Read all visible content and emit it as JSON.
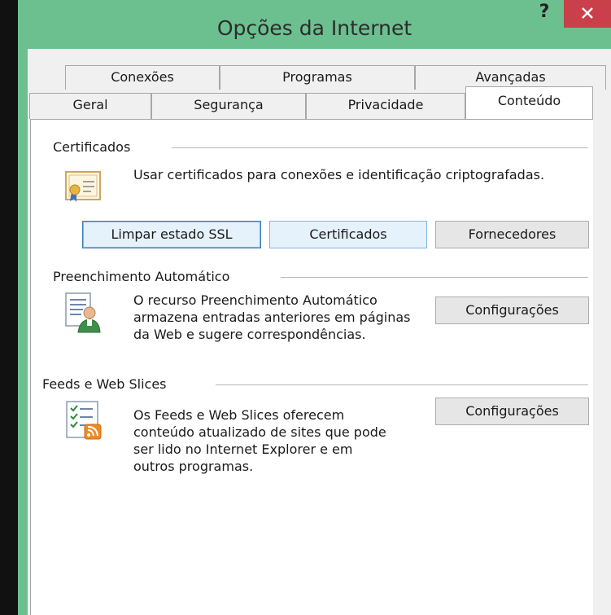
{
  "window": {
    "title": "Opções da Internet",
    "help_label": "?",
    "accent": "#6cc08f",
    "close_color": "#c9404a"
  },
  "tabs": {
    "row1": [
      "Conexões",
      "Programas",
      "Avançadas"
    ],
    "row2": [
      "Geral",
      "Segurança",
      "Privacidade"
    ],
    "active": "Conteúdo"
  },
  "certificates": {
    "label": "Certificados",
    "description": "Usar certificados para conexões e identificação criptografadas.",
    "icon": "certificate-icon",
    "buttons": {
      "clear_ssl": "Limpar estado SSL",
      "certificates": "Certificados",
      "publishers": "Fornecedores"
    }
  },
  "autocomplete": {
    "label": "Preenchimento Automático",
    "lines": [
      "O recurso Preenchimento Automático",
      "armazena entradas anteriores em páginas",
      "da Web e sugere correspondências."
    ],
    "icon": "autocomplete-icon",
    "settings_button": "Configurações"
  },
  "feeds": {
    "label": "Feeds e Web Slices",
    "lines": [
      "Os Feeds e Web Slices oferecem",
      "conteúdo atualizado de sites que pode",
      "ser lido no Internet Explorer e em",
      "outros programas."
    ],
    "icon": "feed-icon",
    "settings_button": "Configurações"
  }
}
